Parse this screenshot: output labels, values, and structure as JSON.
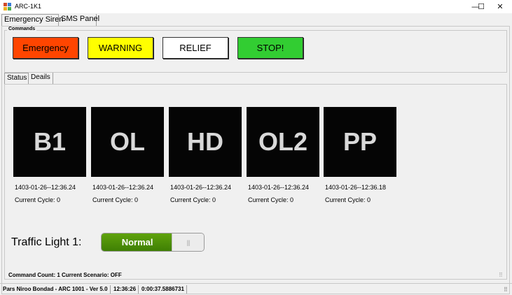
{
  "window": {
    "title": "ARC-1K1",
    "minimize_glyph": "—",
    "maximize_glyph": "☐",
    "close_glyph": "✕"
  },
  "tabs": [
    {
      "label": "Emergency Siren"
    },
    {
      "label": "SMS Panel"
    }
  ],
  "commands": {
    "group_label": "Commands",
    "buttons": [
      {
        "label": "Emergency",
        "color": "#ff4500"
      },
      {
        "label": "WARNING",
        "color": "#ffff00"
      },
      {
        "label": "RELIEF",
        "color": "#ffffff"
      },
      {
        "label": "STOP!",
        "color": "#32cd32"
      }
    ]
  },
  "inner_tabs": [
    {
      "label": "Status"
    },
    {
      "label": "Deails"
    }
  ],
  "tiles": [
    {
      "code": "B1",
      "timestamp": "1403-01-26--12:36.24",
      "cycle": "Current Cycle: 0"
    },
    {
      "code": "OL",
      "timestamp": "1403-01-26--12:36.24",
      "cycle": "Current Cycle: 0"
    },
    {
      "code": "HD",
      "timestamp": "1403-01-26--12:36.24",
      "cycle": "Current Cycle: 0"
    },
    {
      "code": "OL2",
      "timestamp": "1403-01-26--12:36.24",
      "cycle": "Current Cycle: 0"
    },
    {
      "code": "PP",
      "timestamp": "1403-01-26--12:36.18",
      "cycle": "Current Cycle: 0"
    }
  ],
  "traffic_light": {
    "label": "Traffic Light 1:",
    "state": "Normal",
    "knob_glyph": "|||",
    "fill_fraction": 0.7
  },
  "bottom_info": "Command Count: 1  Current Scenario: OFF",
  "status_bar": [
    "Pars Niroo Bondad - ARC 1001 - Ver 5.0",
    "12:36:26",
    "0:00:37.5886731"
  ],
  "resize_grip_glyph": "⠿"
}
